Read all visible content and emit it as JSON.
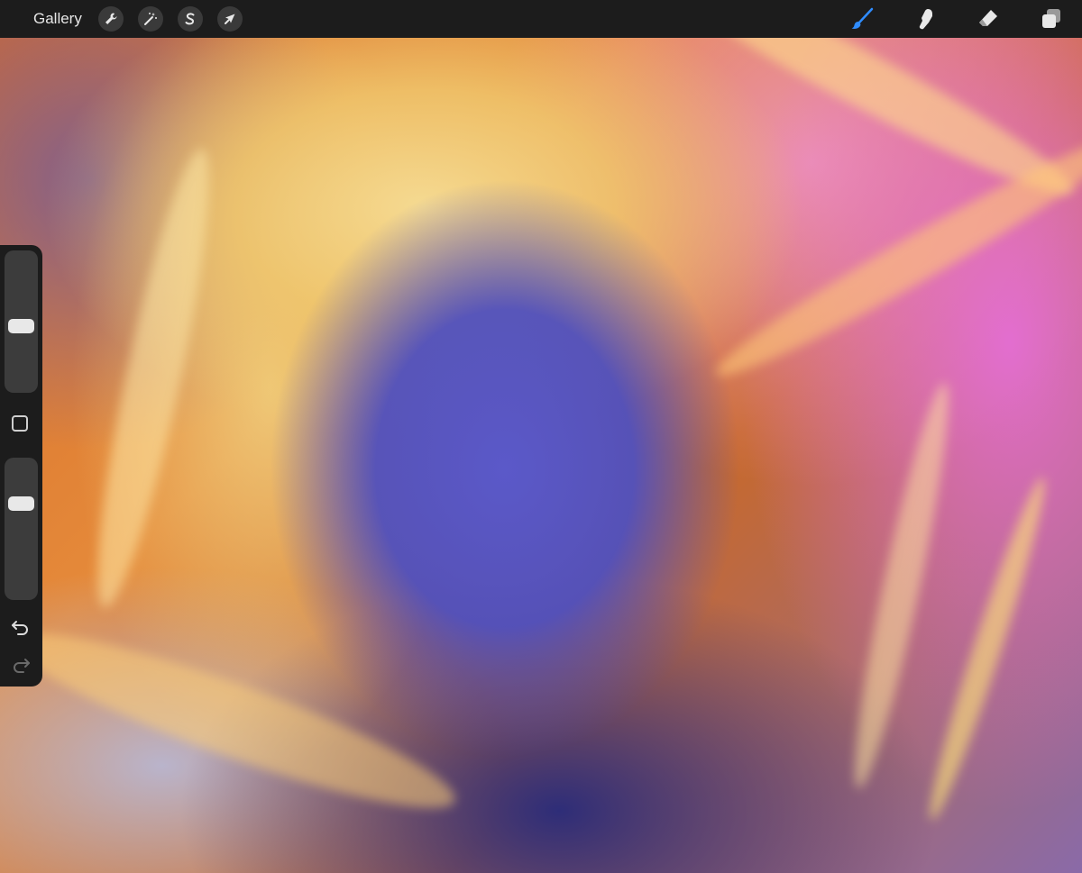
{
  "toolbar": {
    "gallery_label": "Gallery",
    "left_tools": [
      {
        "name": "actions",
        "icon": "wrench-icon"
      },
      {
        "name": "adjustments",
        "icon": "magic-wand-icon"
      },
      {
        "name": "selection",
        "icon": "selection-s-icon"
      },
      {
        "name": "transform",
        "icon": "arrow-cursor-icon"
      }
    ],
    "right_tools": [
      {
        "name": "brush",
        "icon": "brush-icon",
        "active": true
      },
      {
        "name": "smudge",
        "icon": "smudge-finger-icon",
        "active": false
      },
      {
        "name": "eraser",
        "icon": "eraser-icon",
        "active": false
      },
      {
        "name": "layers",
        "icon": "layers-icon",
        "active": false
      }
    ],
    "active_color": "#2f8cff"
  },
  "sidebar": {
    "brush_size": 0.46,
    "brush_opacity": 0.71
  }
}
